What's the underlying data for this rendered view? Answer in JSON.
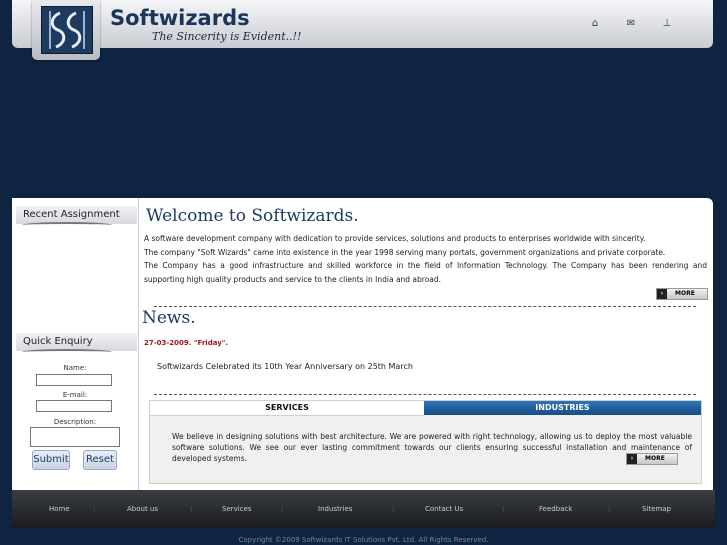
{
  "header": {
    "brand": "Softwizards",
    "tagline": "The Sincerity is Evident..!!",
    "icons": [
      "home-icon",
      "mail-icon",
      "sitemap-icon"
    ]
  },
  "sidebar": {
    "recent_title": "Recent Assignment",
    "enquiry_title": "Quick Enquiry",
    "name_label": "Name:",
    "email_label": "E-mail:",
    "description_label": "Description:",
    "submit_label": "Submit",
    "reset_label": "Reset"
  },
  "welcome": {
    "title": "Welcome to Softwizards.",
    "line1": "A software development company with dedication to provide services, solutions and products to enterprises worldwide with sincerity.",
    "line2": "The company \"Soft Wizards\" came into existence in the year 1998 serving many portals, government organizations and private corporate.",
    "line3": "The Company has a good infrastructure and skilled workforce in the field of Information Technology. The Company has been rendering and supporting high quality products and service to the clients in India and abroad.",
    "more_label": "MORE"
  },
  "news": {
    "title": "News.",
    "date": "27-03-2009. \"Friday\".",
    "item": "Softwizards Celebrated its 10th Year Anniversary on 25th March"
  },
  "tabs": {
    "services": "SERVICES",
    "industries": "INDUSTRIES",
    "text": "We believe in designing solutions with best architecture. We are powered with right technology, allowing us to deploy the most valuable software solutions. We see our ever lasting commitment towards our clients ensuring successful installation and maintenance of developed systems.",
    "more_label": "MORE"
  },
  "footer": {
    "links": [
      "Home",
      "About us",
      "Services",
      "Industries",
      "Contact Us",
      "Feedback",
      "Sitemap"
    ],
    "separator": ":",
    "copyright": "Copyright ©2009 Softwizards IT Solutions Pvt. Ltd. All Rights Reserved."
  },
  "colors": {
    "background": "#0e2440",
    "heading": "#1d3a63",
    "news_date": "#a01818",
    "tab_active": "#1f5c98"
  }
}
